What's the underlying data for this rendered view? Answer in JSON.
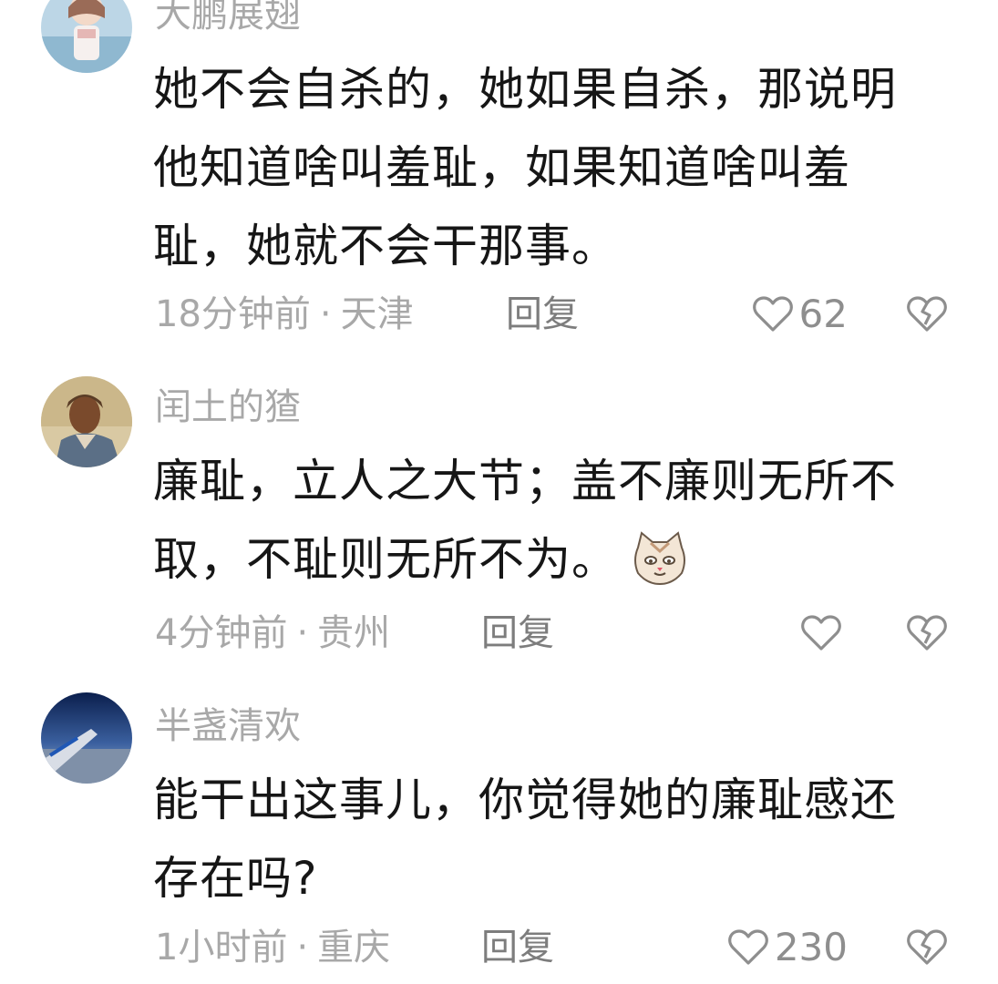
{
  "comments": [
    {
      "username": "大鹏展翅",
      "avatar_icon": "anime-girl-avatar",
      "lines": [
        "她不会自杀的，她如果自杀，那说明",
        "他知道啥叫羞耻，如果知道啥叫羞",
        "耻，她就不会干那事。"
      ],
      "time": "18分钟前",
      "separator": "·",
      "location": "天津",
      "reply_label": "回复",
      "like_count": "62"
    },
    {
      "username": "闰土的猹",
      "avatar_icon": "painted-portrait-avatar",
      "lines": [
        "廉耻，立人之大节；盖不廉则无所不",
        "取，不耻则无所不为。"
      ],
      "emoji_icon": "smug-cat-emoji",
      "time": "4分钟前",
      "separator": "·",
      "location": "贵州",
      "reply_label": "回复",
      "like_count": ""
    },
    {
      "username": "半盏清欢",
      "avatar_icon": "airplane-wing-sky-avatar",
      "lines": [
        "能干出这事儿，你觉得她的廉耻感还",
        "存在吗?"
      ],
      "time": "1小时前",
      "separator": "·",
      "location": "重庆",
      "reply_label": "回复",
      "like_count": "230"
    }
  ],
  "icons": {
    "like": "heart-outline-icon",
    "dislike": "broken-heart-icon"
  },
  "colors": {
    "username": "#a8a8a8",
    "text": "#161616",
    "meta": "#a8a8a8",
    "reply": "#7d7d7d",
    "icon": "#8e8e8e"
  }
}
